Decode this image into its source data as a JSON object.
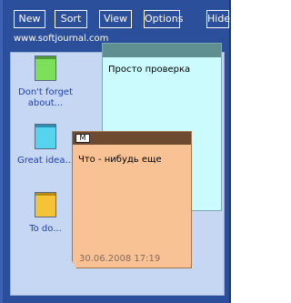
{
  "toolbar": {
    "new_label": "New",
    "sort_label": "Sort",
    "view_label": "View",
    "options_label": "Options",
    "hide_label": "Hide"
  },
  "site_url": "www.softjournal.com",
  "desktop_icons": [
    {
      "label_line1": "Don't forget",
      "label_line2": "about...",
      "color": "#7de05a"
    },
    {
      "label_line1": "Great idea...",
      "label_line2": "",
      "color": "#55d3ef"
    },
    {
      "label_line1": "To do...",
      "label_line2": "",
      "color": "#f4c436"
    }
  ],
  "notes": [
    {
      "text": "Просто проверка",
      "color": "#ccfbfd",
      "bar_color": "#5f8f90"
    },
    {
      "text": "Что - нибудь еще",
      "date": "30.06.2008 17:19",
      "button_label": "M",
      "color": "#f9c294",
      "bar_color": "#6e4a30"
    }
  ],
  "colors": {
    "frame": "#2c4f9c",
    "panel": "#c6d7f4",
    "label_text": "#1f3fa8"
  }
}
